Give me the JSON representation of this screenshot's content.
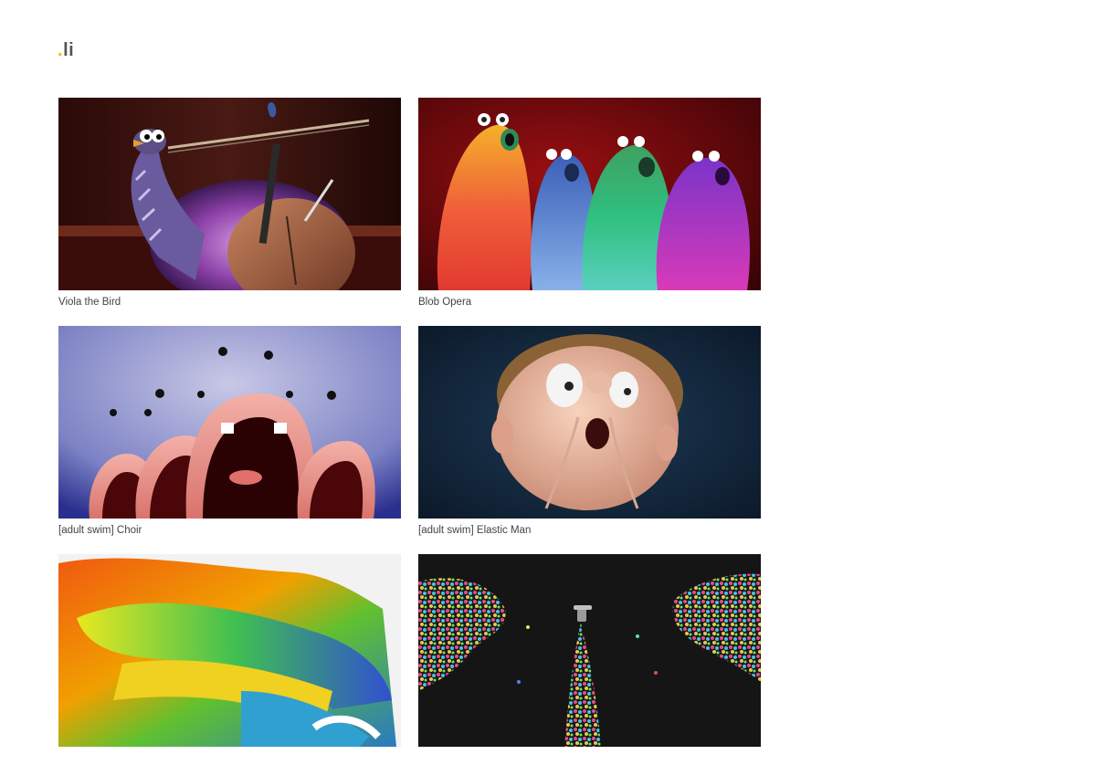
{
  "site": {
    "logo_dot": ".",
    "logo_text": "li",
    "accent_color": "#f2c200",
    "text_color": "#444444"
  },
  "projects": [
    {
      "title": "Viola the Bird",
      "thumbnail": "bird-with-violin-thumbnail"
    },
    {
      "title": "Blob Opera",
      "thumbnail": "singing-blobs-thumbnail"
    },
    {
      "title": "[adult swim] Choir",
      "thumbnail": "singing-mouths-thumbnail"
    },
    {
      "title": "[adult swim] Elastic Man",
      "thumbnail": "elastic-face-thumbnail"
    },
    {
      "title": "",
      "thumbnail": "paint-strokes-thumbnail"
    },
    {
      "title": "",
      "thumbnail": "particle-fountain-thumbnail"
    }
  ]
}
